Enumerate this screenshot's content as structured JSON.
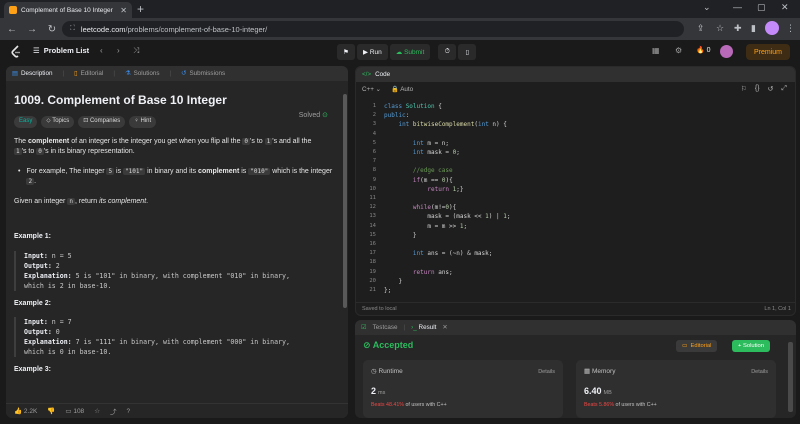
{
  "browser": {
    "tab_title": "Complement of Base 10 Integer",
    "url_host": "leetcode.com",
    "url_path": "/problems/complement-of-base-10-integer/"
  },
  "nav": {
    "problem_list": "Problem List",
    "run": "Run",
    "submit": "Submit",
    "streak": "0",
    "premium": "Premium"
  },
  "left": {
    "tabs": [
      "Description",
      "Editorial",
      "Solutions",
      "Submissions"
    ],
    "title": "1009. Complement of Base 10 Integer",
    "solved": "Solved",
    "chips": [
      "Easy",
      "Topics",
      "Companies",
      "Hint"
    ],
    "p1_pre": "The ",
    "p1_bold": "complement",
    "p1_a": " of an integer is the integer you get when you flip all the ",
    "p1_c0": "0",
    "p1_b": "'s to ",
    "p1_c1": "1",
    "p1_c": "'s and all the ",
    "p1_d": "'s to ",
    "p1_e": "'s in its binary representation.",
    "bullet_a": "For example, The integer ",
    "bullet_c5": "5",
    "bullet_b": " is ",
    "bullet_c101": "\"101\"",
    "bullet_c": " in binary and its ",
    "bullet_bold": "complement",
    "bullet_d": " is ",
    "bullet_c010": "\"010\"",
    "bullet_e": " which is the integer ",
    "bullet_c2": "2",
    "bullet_f": ".",
    "p2_a": "Given an integer ",
    "p2_cn": "n",
    "p2_b": ", return ",
    "p2_em": "its complement",
    "p2_c": ".",
    "ex1_title": "Example 1:",
    "ex1_input_lbl": "Input:",
    "ex1_input": " n = 5",
    "ex1_output_lbl": "Output:",
    "ex1_output": " 2",
    "ex1_expl_lbl": "Explanation:",
    "ex1_expl1": " 5 is \"101\" in binary, with complement \"010\" in binary,",
    "ex1_expl2": "which is 2 in base-10.",
    "ex2_title": "Example 2:",
    "ex2_input": " n = 7",
    "ex2_output": " 0",
    "ex2_expl1": " 7 is \"111\" in binary, with complement \"000\" in binary,",
    "ex2_expl2": "which is 0 in base-10.",
    "ex3_title": "Example 3:",
    "likes": "2.2K",
    "comments": "108"
  },
  "code": {
    "tab": "Code",
    "lang": "C++",
    "mode": "Auto",
    "lines": [
      "class Solution {",
      "public:",
      "    int bitwiseComplement(int n) {",
      "",
      "        int m = n;",
      "        int mask = 0;",
      "",
      "        //edge case",
      "        if(m == 0){",
      "            return 1;}",
      "",
      "        while(m!=0){",
      "            mask = (mask << 1) | 1;",
      "            m = m >> 1;",
      "        }",
      "",
      "        int ans = (~n) & mask;",
      "",
      "        return ans;",
      "    }",
      "};"
    ],
    "saved": "Saved to local",
    "cursor": "Ln 1, Col 1"
  },
  "result": {
    "tab_testcase": "Testcase",
    "tab_result": "Result",
    "status": "Accepted",
    "editorial": "Editorial",
    "solution": "+ Solution",
    "runtime_label": "Runtime",
    "runtime_val": "2",
    "runtime_unit": "ms",
    "runtime_beats_pre": "Beats ",
    "runtime_beats_pct": "48.41%",
    "runtime_beats_post": " of users with C++",
    "memory_label": "Memory",
    "memory_val": "6.40",
    "memory_unit": "MB",
    "memory_beats_pre": "Beats ",
    "memory_beats_pct": "5.86%",
    "memory_beats_post": " of users with C++",
    "details": "Details"
  },
  "colors": {
    "accent_orange": "#ffa116",
    "accepted_green": "#2cbb5d",
    "easy_teal": "#00b8a3"
  }
}
